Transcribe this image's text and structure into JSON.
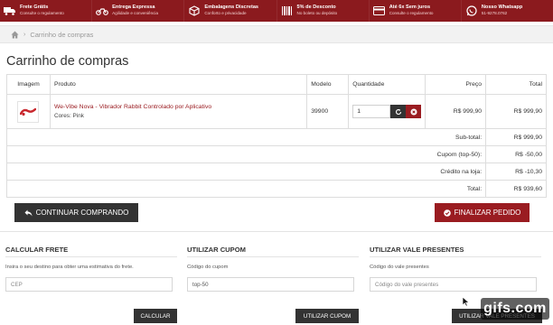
{
  "perks": [
    {
      "title": "Frete Grátis",
      "subtitle": "Consulte o regulamento",
      "icon": "truck-icon"
    },
    {
      "title": "Entrega Expressa",
      "subtitle": "Agilidade e conveniência",
      "icon": "motorcycle-icon"
    },
    {
      "title": "Embalagens Discretas",
      "subtitle": "Conforto e privacidade",
      "icon": "package-icon"
    },
    {
      "title": "5% de Desconto",
      "subtitle": "No boleto ou depósito",
      "icon": "barcode-icon"
    },
    {
      "title": "Até 6x Sem juros",
      "subtitle": "Consulte o regulamento",
      "icon": "credit-card-icon"
    },
    {
      "title": "Nosso Whatsapp",
      "subtitle": "51-9278.0762",
      "icon": "whatsapp-icon"
    }
  ],
  "breadcrumb": {
    "items": [
      "Carrinho de compras"
    ]
  },
  "page": {
    "title": "Carrinho de compras"
  },
  "cart": {
    "headers": {
      "image": "Imagem",
      "product": "Produto",
      "model": "Modelo",
      "quantity": "Quantidade",
      "price": "Preço",
      "total": "Total"
    },
    "item": {
      "name": "We-Vibe Nova - Vibrador Rabbit Controlado por Aplicativo",
      "option": "Cores: Pink",
      "model": "39900",
      "quantity": "1",
      "price": "R$ 999,90",
      "total": "R$ 999,90"
    },
    "totals": [
      {
        "label": "Sub-total:",
        "value": "R$ 999,90"
      },
      {
        "label": "Cupom (top-50):",
        "value": "R$ -50,00"
      },
      {
        "label": "Crédito na loja:",
        "value": "R$ -10,30"
      },
      {
        "label": "Total:",
        "value": "R$ 939,60"
      }
    ]
  },
  "actions": {
    "continue_label": "CONTINUAR COMPRANDO",
    "checkout_label": "FINALIZAR PEDIDO"
  },
  "shipping": {
    "title": "CALCULAR FRETE",
    "description": "Insira o seu destino para obter uma estimativa do frete.",
    "placeholder": "CEP",
    "button": "CALCULAR"
  },
  "coupon": {
    "title": "UTILIZAR CUPOM",
    "label": "Código do cupom",
    "value": "top-50",
    "button": "UTILIZAR CUPOM"
  },
  "voucher": {
    "title": "UTILIZAR VALE PRESENTES",
    "label": "Código do vale presentes",
    "placeholder": "Código do vale presentes",
    "button": "UTILIZAR VALE PRESENTES"
  },
  "watermark": {
    "text": "gifs.com"
  },
  "colors": {
    "brand": "#8b1a1e",
    "accent": "#9a1c21",
    "dark_button": "#333333"
  }
}
